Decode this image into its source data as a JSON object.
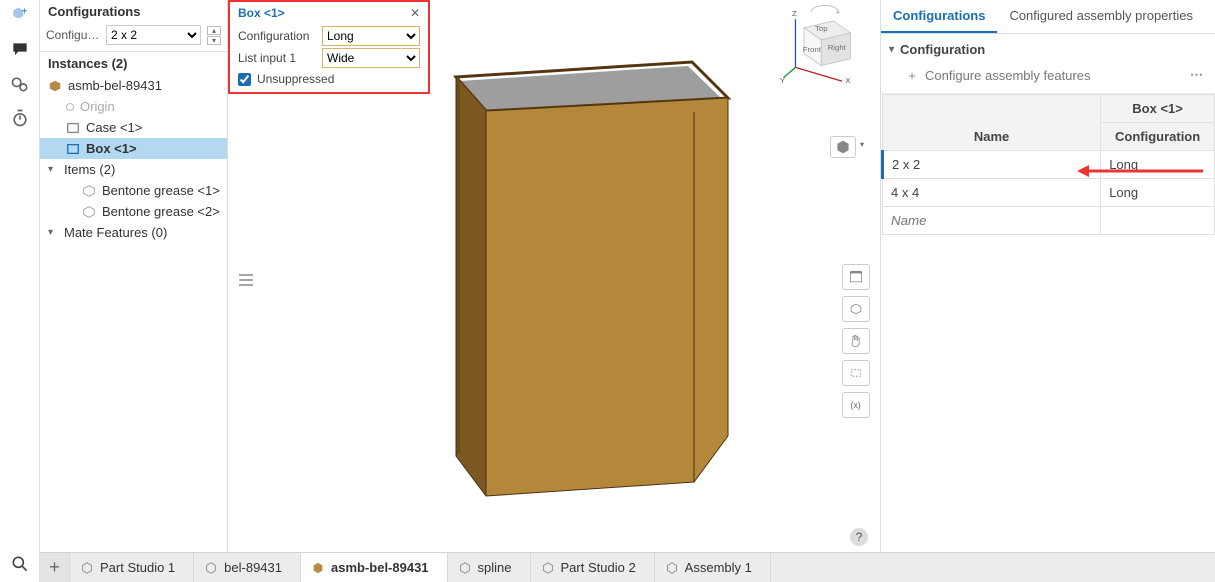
{
  "leftPanel": {
    "configurations_header": "Configurations",
    "config_label": "Configurati...",
    "config_value": "2 x 2",
    "instances_header": "Instances (2)",
    "tree": {
      "root": "asmb-bel-89431",
      "origin": "Origin",
      "case": "Case <1>",
      "box": "Box <1>",
      "items_group": "Items (2)",
      "item1": "Bentone grease <1>",
      "item2": "Bentone grease <2>",
      "mates_group": "Mate Features (0)"
    }
  },
  "popup": {
    "title": "Box <1>",
    "config_label": "Configuration",
    "config_value": "Long",
    "list_label": "List input 1",
    "list_value": "Wide",
    "unsuppressed": "Unsuppressed"
  },
  "viewcube": {
    "top": "Top",
    "front": "Front",
    "right": "Right",
    "z": "Z",
    "y": "Y",
    "x": "X"
  },
  "rightPanel": {
    "tab_configs": "Configurations",
    "tab_props": "Configured assembly properties",
    "section_header": "Configuration",
    "configure_features": "Configure assembly features",
    "col_box": "Box <1>",
    "col_name": "Name",
    "col_config": "Configuration",
    "rows": [
      {
        "name": "2 x 2",
        "config": "Long"
      },
      {
        "name": "4 x 4",
        "config": "Long"
      }
    ],
    "name_placeholder": "Name"
  },
  "tabs": {
    "t1": "Part Studio 1",
    "t2": "bel-89431",
    "t3": "asmb-bel-89431",
    "t4": "spline",
    "t5": "Part Studio 2",
    "t6": "Assembly 1"
  }
}
